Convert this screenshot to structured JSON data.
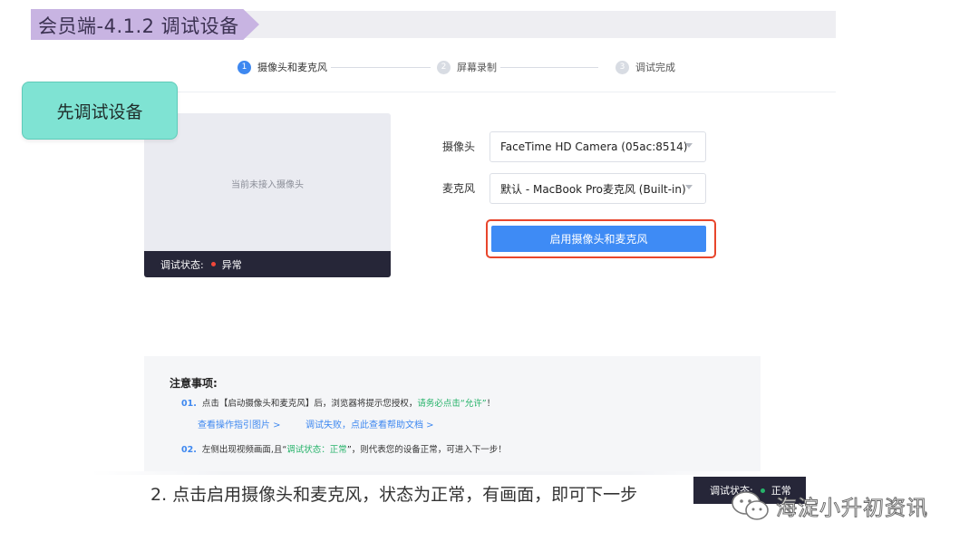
{
  "header": {
    "title": "会员端-4.1.2  调试设备"
  },
  "stepper": {
    "steps": [
      {
        "num": "1",
        "label": "摄像头和麦克风"
      },
      {
        "num": "2",
        "label": "屏幕录制"
      },
      {
        "num": "3",
        "label": "调试完成"
      }
    ]
  },
  "callout": {
    "text": "先调试设备"
  },
  "preview": {
    "placeholder": "当前未接入摄像头",
    "status_label": "调试状态:",
    "status_value": "异常",
    "status_color": "#f0473a"
  },
  "form": {
    "camera_label": "摄像头",
    "camera_value": "FaceTime HD Camera (05ac:8514)",
    "mic_label": "麦克风",
    "mic_value": "默认 - MacBook Pro麦克风 (Built-in)",
    "enable_button": "启用摄像头和麦克风"
  },
  "notes": {
    "title": "注意事项:",
    "item1_num": "01.",
    "item1_text": "点击【启动摄像头和麦克风】后，浏览器将提示您授权，",
    "item1_emph": "请务必点击“允许”",
    "item1_end": "！",
    "link1": "查看操作指引图片 >",
    "link2": "调试失败，点此查看帮助文档 >",
    "item2_num": "02.",
    "item2_text": "左侧出现视频画面,且“",
    "item2_emph": "调试状态：正常",
    "item2_end": "”，则代表您的设备正常，可进入下一步！"
  },
  "caption": {
    "text": "2. 点击启用摄像头和麦克风，状态为正常，有画面，即可下一步"
  },
  "mini_status": {
    "label": "调试状态:",
    "value": "正常",
    "color": "#26b36a"
  },
  "watermark": {
    "text": "海淀小升初资讯"
  },
  "colors": {
    "accent": "#3e88f0",
    "button": "#3e8bf5",
    "highlight_frame": "#e8462c",
    "callout": "#7fe3d3"
  }
}
